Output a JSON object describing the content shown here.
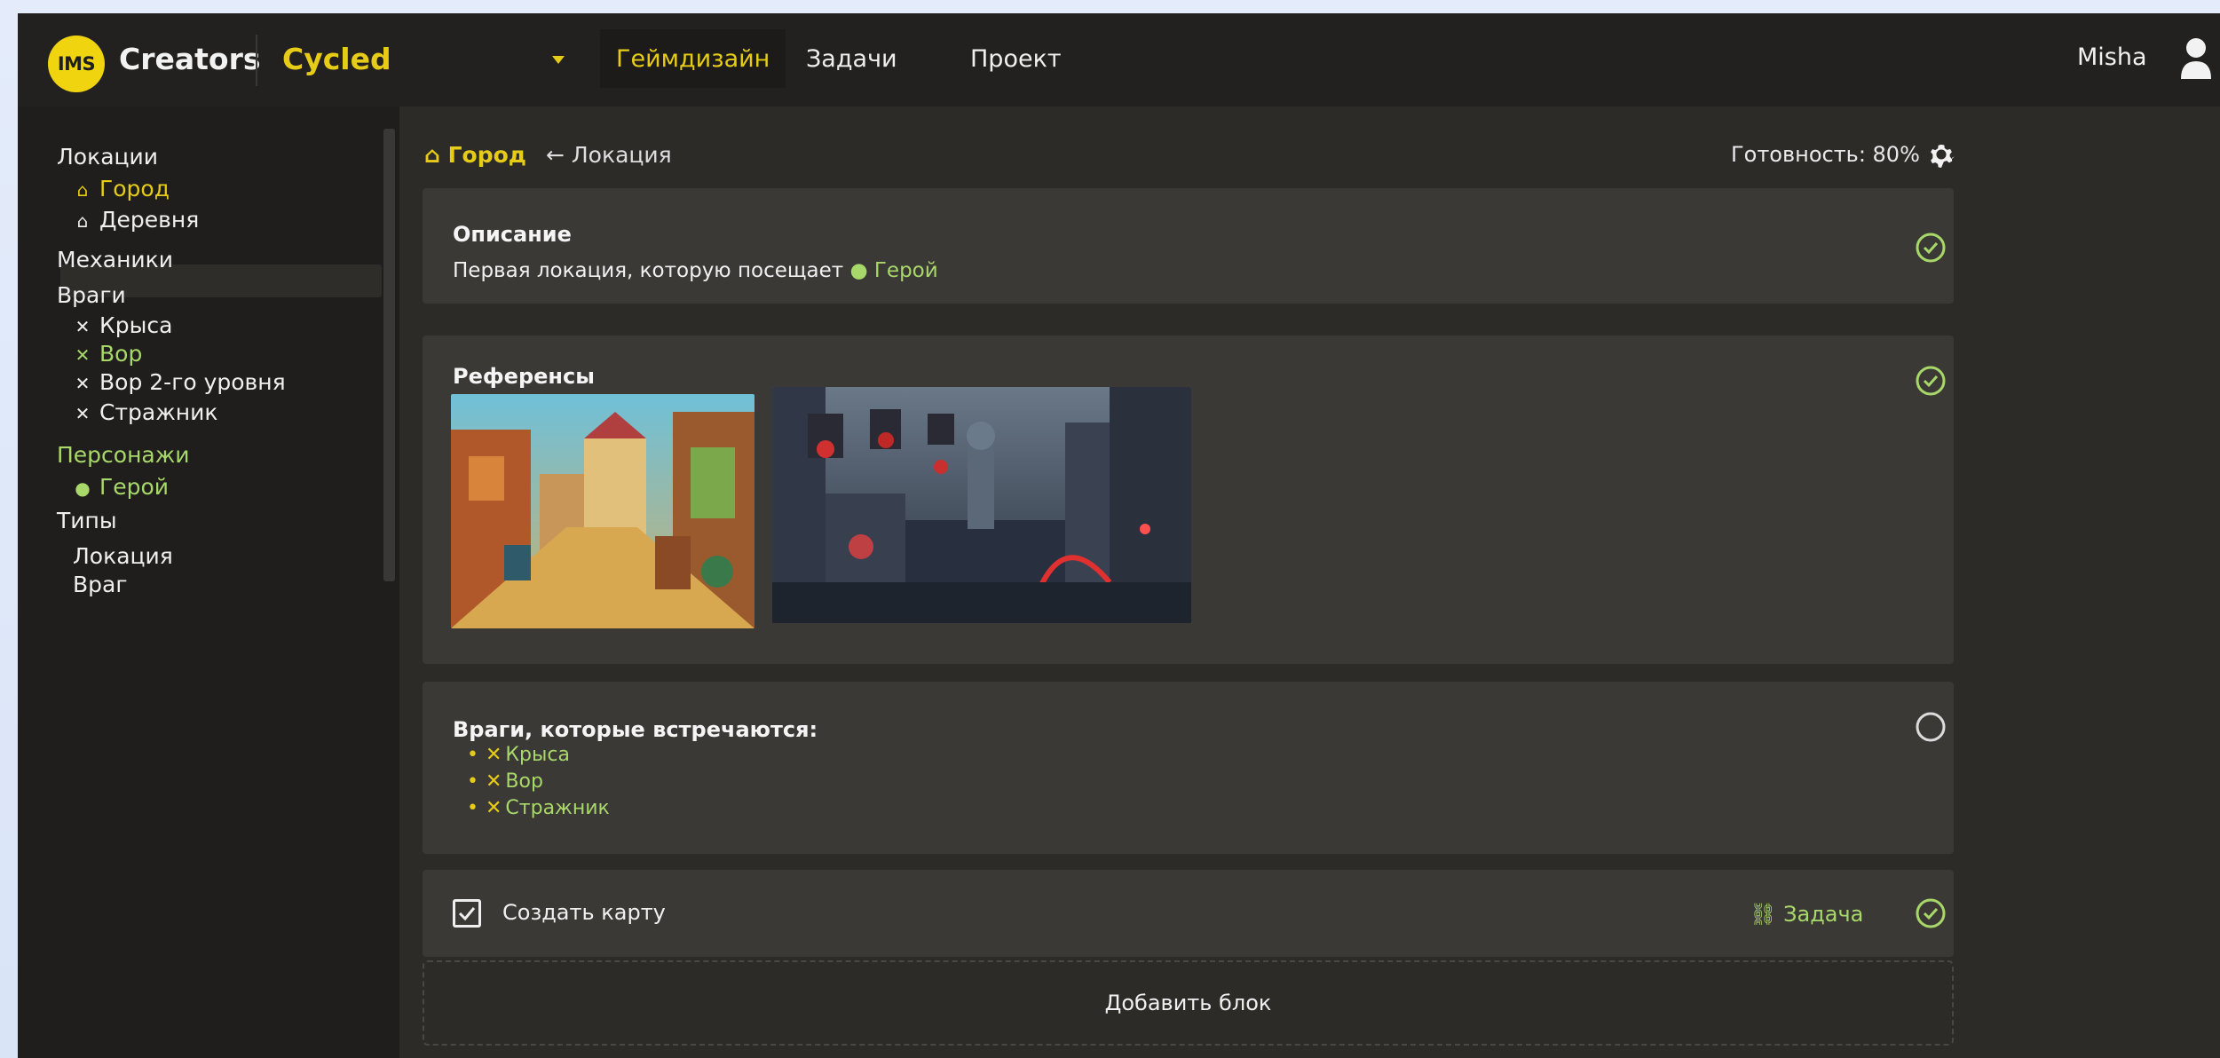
{
  "header": {
    "logo_badge": "IMS",
    "logo_text": "Creators",
    "project": "Cycled",
    "tabs": [
      {
        "label": "Геймдизайн",
        "active": true
      },
      {
        "label": "Задачи",
        "active": false
      },
      {
        "label": "Проект",
        "active": false
      }
    ],
    "user": "Misha"
  },
  "sidebar": {
    "groups": [
      {
        "label": "Локации"
      },
      {
        "label": "Механики"
      },
      {
        "label": "Враги"
      },
      {
        "label": "Персонажи"
      },
      {
        "label": "Типы"
      }
    ],
    "locations": [
      {
        "label": "Город",
        "icon": "home-icon",
        "selected": true
      },
      {
        "label": "Деревня",
        "icon": "home-icon",
        "selected": false
      }
    ],
    "enemies": [
      {
        "label": "Крыса",
        "icon": "crossed-swords-icon"
      },
      {
        "label": "Вор",
        "icon": "crossed-swords-icon"
      },
      {
        "label": "Вор 2-го уровня",
        "icon": "crossed-swords-icon"
      },
      {
        "label": "Стражник",
        "icon": "crossed-swords-icon"
      }
    ],
    "characters": [
      {
        "label": "Герой",
        "icon": "user-icon"
      }
    ],
    "types": [
      {
        "label": "Локация"
      },
      {
        "label": "Враг"
      }
    ]
  },
  "main": {
    "breadcrumb": {
      "current": "Город",
      "parent": "← Локация"
    },
    "readiness": "Готовность: 80%",
    "description": {
      "title": "Описание",
      "text": "Первая локация, которую посещает",
      "link": "Герой",
      "done": true
    },
    "references": {
      "title": "Референсы",
      "done": true
    },
    "enemies_block": {
      "title": "Враги, которые встречаются:",
      "items": [
        "Крыса",
        "Вор",
        "Стражник"
      ],
      "done": false
    },
    "task_block": {
      "label": "Создать карту",
      "checked": true,
      "link": "Задача",
      "done": true
    },
    "add_block": "Добавить блок"
  },
  "colors": {
    "accent_yellow": "#e6cc17",
    "accent_green": "#a8d86a",
    "panel": "#3b3936",
    "background": "#2d2b28"
  }
}
